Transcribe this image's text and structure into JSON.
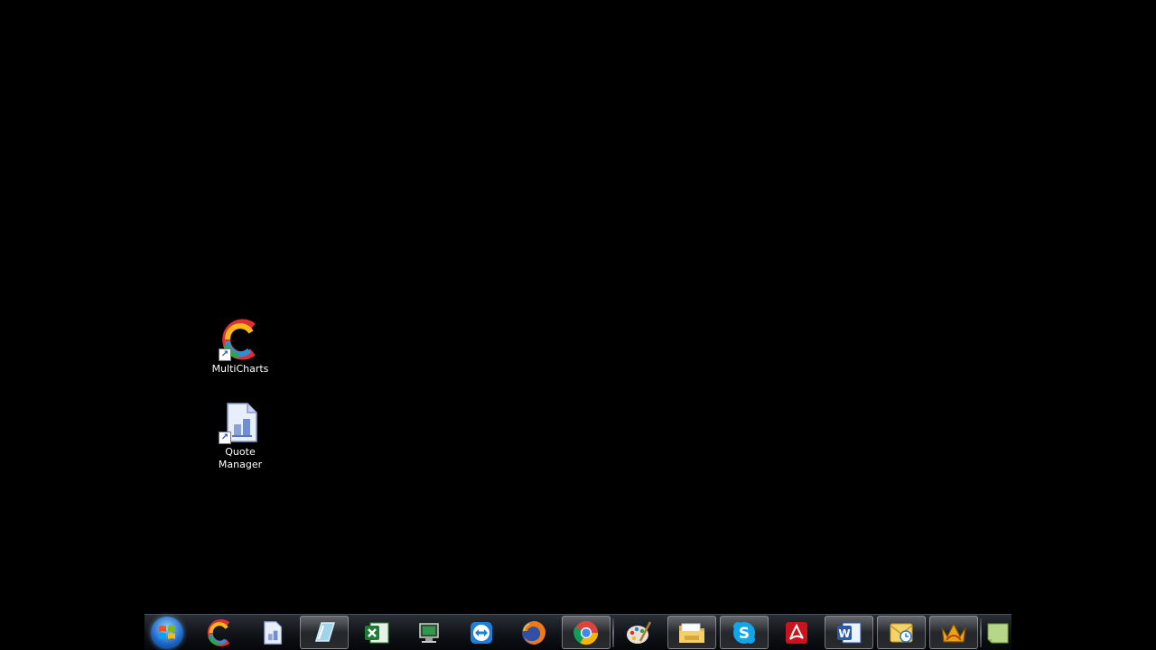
{
  "desktop": {
    "icons": [
      {
        "label": "MultiCharts",
        "icon": "multicharts-icon"
      },
      {
        "label": "Quote\nManager",
        "icon": "quote-manager-icon"
      }
    ]
  },
  "taskbar": {
    "items": [
      {
        "name": "start-button",
        "icon": "windows-logo-icon"
      },
      {
        "name": "multicharts",
        "icon": "multicharts-icon"
      },
      {
        "name": "quote-manager",
        "icon": "quote-manager-icon"
      },
      {
        "name": "editor",
        "icon": "editor-icon",
        "running": true
      },
      {
        "name": "excel",
        "icon": "excel-icon"
      },
      {
        "name": "remote-desktop",
        "icon": "remote-desktop-icon"
      },
      {
        "name": "teamviewer",
        "icon": "teamviewer-icon"
      },
      {
        "name": "firefox",
        "icon": "firefox-icon"
      },
      {
        "name": "chrome",
        "icon": "chrome-icon",
        "running": true
      },
      {
        "name": "paint",
        "icon": "paint-icon"
      },
      {
        "name": "explorer",
        "icon": "folder-icon",
        "running": true
      },
      {
        "name": "skype",
        "icon": "skype-icon",
        "running": true
      },
      {
        "name": "acrobat",
        "icon": "acrobat-icon"
      },
      {
        "name": "word",
        "icon": "word-icon",
        "running": true
      },
      {
        "name": "outlook",
        "icon": "outlook-icon",
        "running": true
      },
      {
        "name": "app-crown",
        "icon": "crown-icon",
        "running": true
      },
      {
        "name": "notes",
        "icon": "notes-icon"
      }
    ]
  }
}
